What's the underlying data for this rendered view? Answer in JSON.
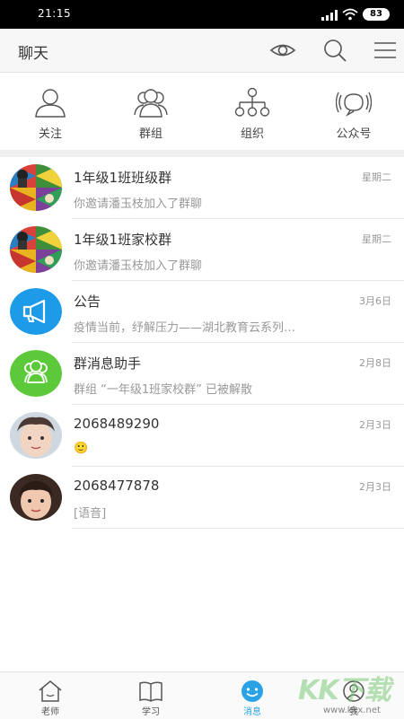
{
  "status_bar": {
    "time": "21:15",
    "battery": "83"
  },
  "header": {
    "title": "聊天",
    "icons": [
      "eye-icon",
      "search-icon",
      "menu-icon"
    ]
  },
  "quick_actions": [
    {
      "label": "关注",
      "icon": "person-icon"
    },
    {
      "label": "群组",
      "icon": "group-icon"
    },
    {
      "label": "组织",
      "icon": "org-tree-icon"
    },
    {
      "label": "公众号",
      "icon": "broadcast-icon"
    }
  ],
  "conversations": [
    {
      "name": "1年级1班班级群",
      "message": "你邀请潘玉枝加入了群聊",
      "time": "星期二",
      "avatar": "collage"
    },
    {
      "name": "1年级1班家校群",
      "message": "你邀请潘玉枝加入了群聊",
      "time": "星期二",
      "avatar": "collage"
    },
    {
      "name": "公告",
      "message": "疫情当前，纾解压力——湖北教育云系列…",
      "time": "3月6日",
      "avatar": "megaphone"
    },
    {
      "name": "群消息助手",
      "message": "群组 “一年级1班家校群” 已被解散",
      "time": "2月8日",
      "avatar": "group-assistant"
    },
    {
      "name": "2068489290",
      "message": "🙂",
      "time": "2月3日",
      "avatar": "photo"
    },
    {
      "name": "2068477878",
      "message": "[语音]",
      "time": "2月3日",
      "avatar": "photo"
    }
  ],
  "tabs": [
    {
      "label": "老师",
      "icon": "home-icon"
    },
    {
      "label": "学习",
      "icon": "book-icon"
    },
    {
      "label": "消息",
      "icon": "chat-icon",
      "active": true
    },
    {
      "label": "我",
      "icon": "profile-icon"
    }
  ],
  "watermark": {
    "text": "KK下载",
    "url": "www.kkx.net"
  },
  "colors": {
    "accent": "#2aa3e6",
    "notice_avatar": "#1e9be8",
    "assistant_avatar": "#5cc93a"
  }
}
